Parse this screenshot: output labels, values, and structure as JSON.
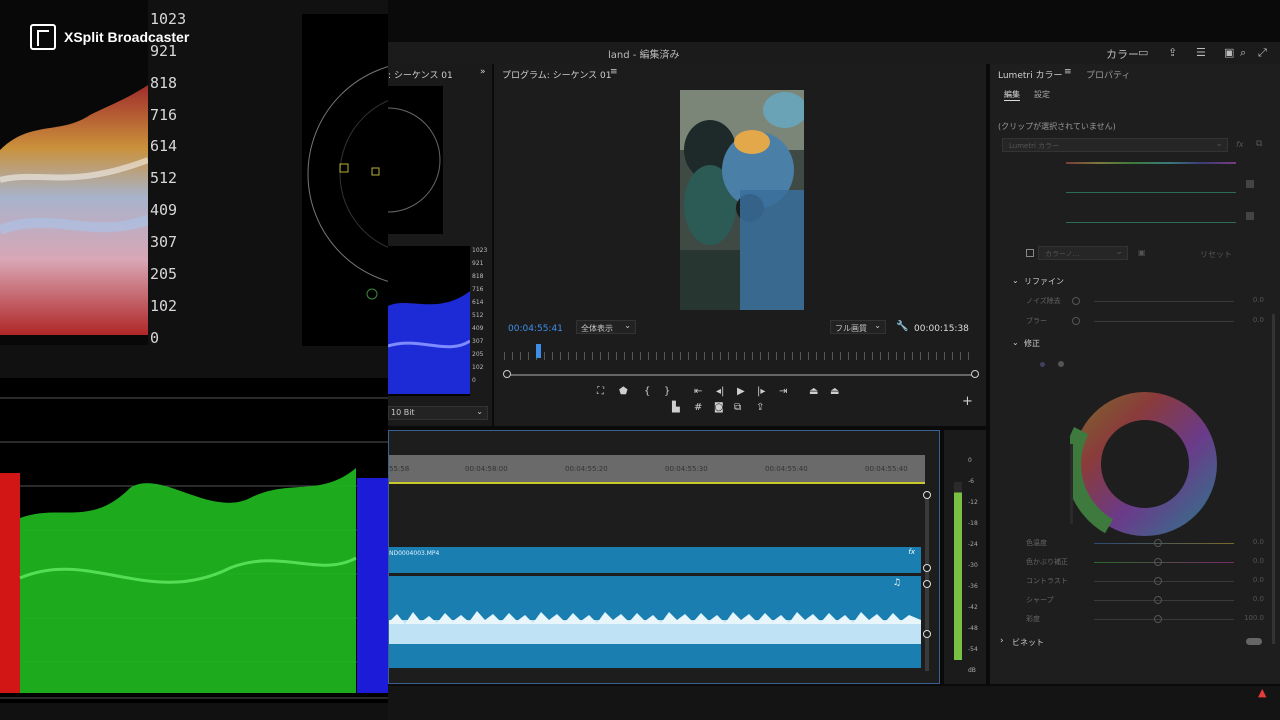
{
  "overlay": {
    "brand": "XSplit Broadcaster",
    "scale": [
      "1023",
      "921",
      "818",
      "716",
      "614",
      "512",
      "409",
      "307",
      "205",
      "102",
      "0"
    ]
  },
  "window": {
    "title": "land - 編集済み",
    "header_label": "カラー"
  },
  "source_panel": {
    "tab": ": シーケンス 01",
    "scale": [
      "1023",
      "921",
      "818",
      "716",
      "614",
      "512",
      "409",
      "307",
      "205",
      "102",
      "0"
    ],
    "bit_depth": "10 Bit"
  },
  "program": {
    "tab": "プログラム: シーケンス 01",
    "current_time": "00:04:55:41",
    "fit_select": "全体表示",
    "quality_select": "フル画質",
    "duration": "00:00:15:38"
  },
  "timeline": {
    "ruler": [
      "55:58",
      "00:04:58:00",
      "00:04:55:20",
      "00:04:55:30",
      "00:04:55:40"
    ],
    "clip_name": "ND0004003.MP4",
    "clip_fx": "fx"
  },
  "meter": {
    "scale": [
      "0",
      "-6",
      "-12",
      "-18",
      "-24",
      "-30",
      "-36",
      "-42",
      "-48",
      "-54",
      "dB"
    ]
  },
  "lumetri": {
    "tab_active": "Lumetri カラー",
    "tab_other": "プロパティ",
    "sub_edit": "編集",
    "sub_settings": "設定",
    "no_clip": "(クリップが選択されていません)",
    "effect_select": "Lumetri カラー",
    "fx": "fx",
    "lut_select": "カラーノ…",
    "reset": "リセット",
    "refine_label": "リファイン",
    "refine_rows": [
      {
        "label": "ノイズ除去",
        "value": "0.0"
      },
      {
        "label": "ブラー",
        "value": "0.0"
      }
    ],
    "correct_label": "修正",
    "correct_rows": [
      {
        "label": "色温度",
        "value": "0.0"
      },
      {
        "label": "色かぶり補正",
        "value": "0.0"
      },
      {
        "label": "コントラスト",
        "value": "0.0"
      },
      {
        "label": "シャープ",
        "value": "0.0"
      },
      {
        "label": "彩度",
        "value": "100.0"
      }
    ],
    "vignette_label": "ビネット"
  }
}
